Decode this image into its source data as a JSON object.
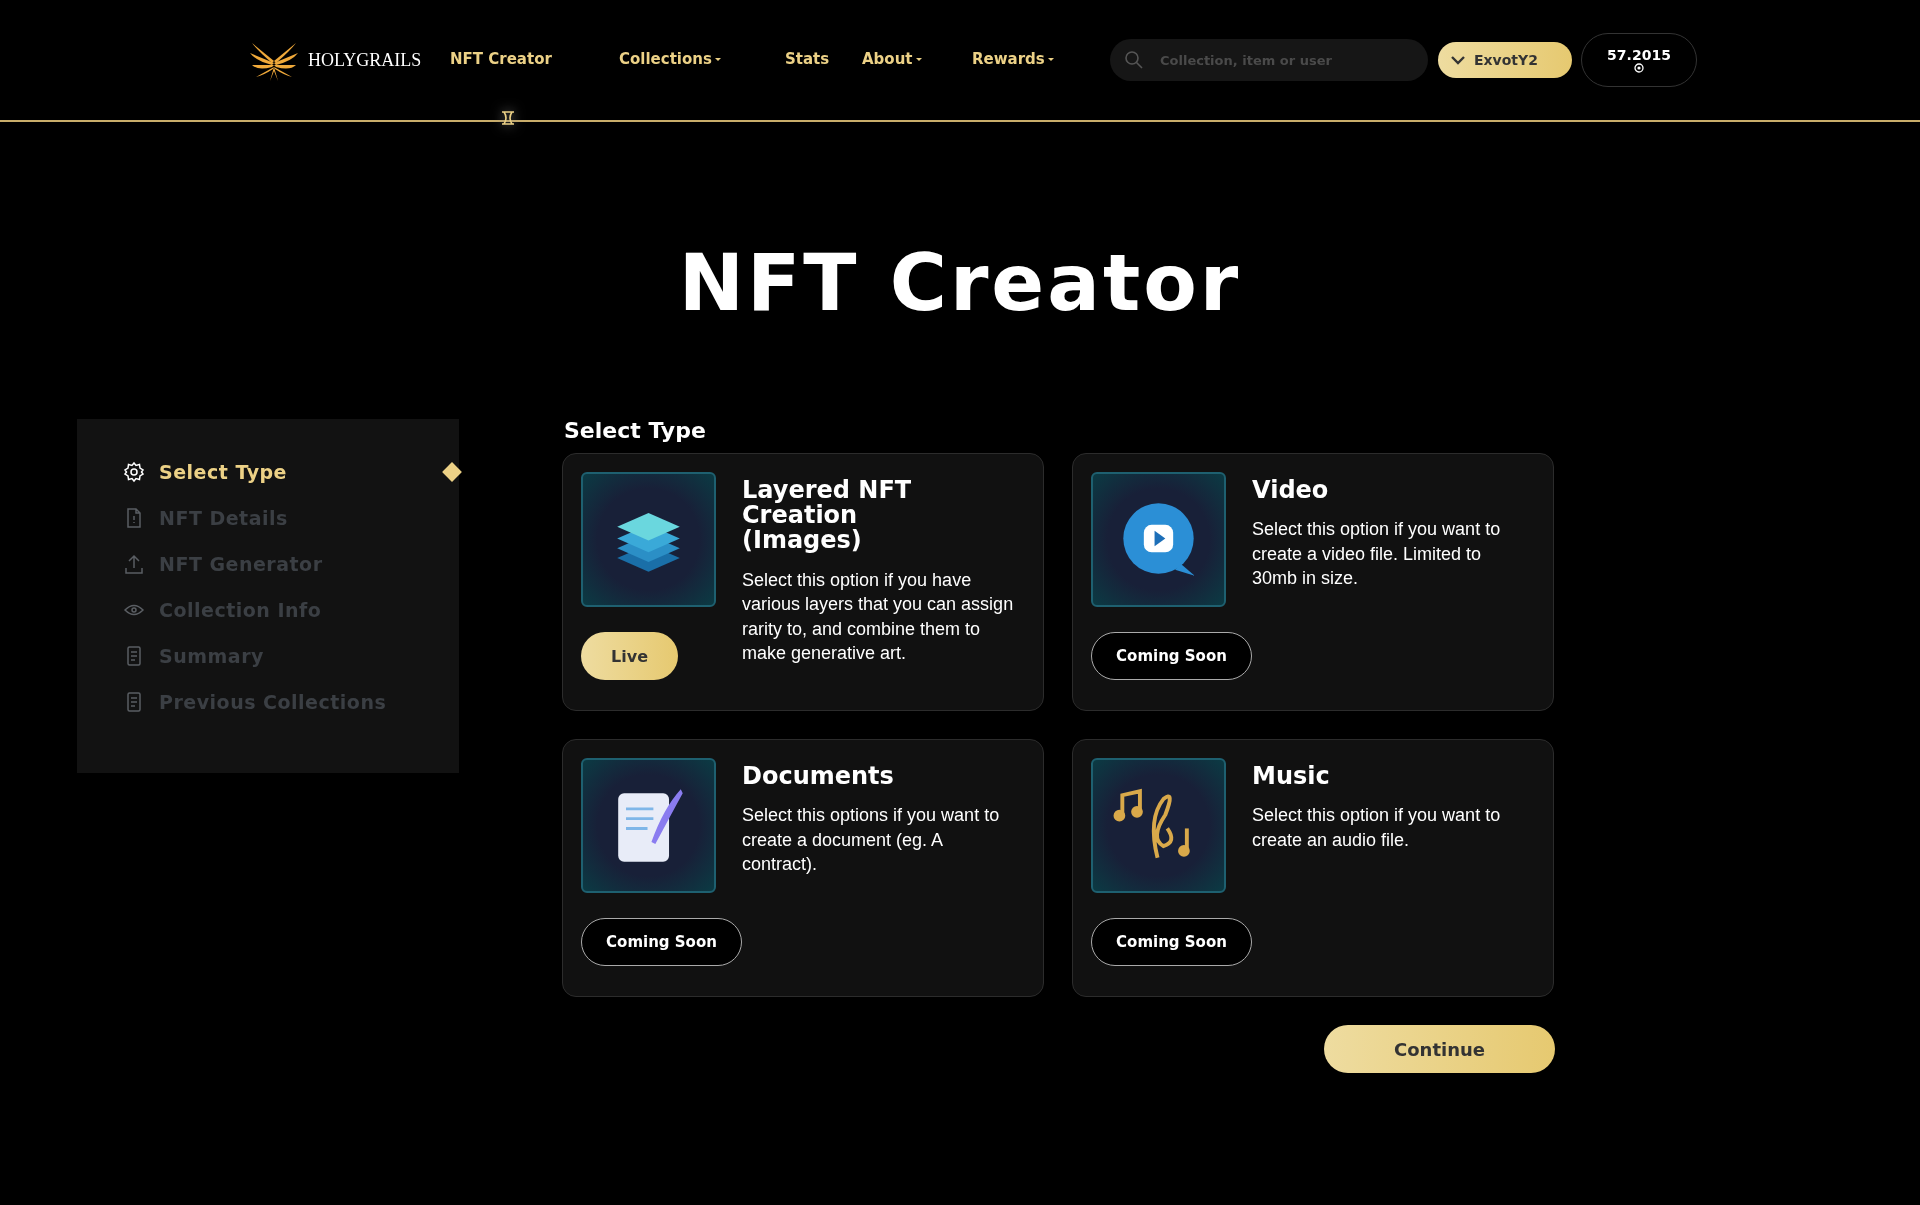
{
  "header": {
    "logo_text": "HOLYGRAILS",
    "nav": [
      {
        "label": "NFT Creator",
        "selected": true,
        "has_menu": false
      },
      {
        "label": "Collections",
        "selected": false,
        "has_menu": true
      },
      {
        "label": "Stats",
        "selected": false,
        "has_menu": false
      },
      {
        "label": "About",
        "selected": false,
        "has_menu": true
      },
      {
        "label": "Rewards",
        "selected": false,
        "has_menu": true
      }
    ],
    "search": {
      "placeholder": "Collection, item or user"
    },
    "user": "ExvotY2",
    "balance": "57.2015"
  },
  "title": "NFT Creator",
  "sidebar": {
    "items": [
      {
        "label": "Select Type",
        "selected": true
      },
      {
        "label": "NFT Details",
        "selected": false
      },
      {
        "label": "NFT Generator",
        "selected": false
      },
      {
        "label": "Collection Info",
        "selected": false
      },
      {
        "label": "Summary",
        "selected": false
      },
      {
        "label": "Previous Collections",
        "selected": false
      }
    ]
  },
  "section_title": "Select Type",
  "cards": [
    {
      "title": "Layered NFT Creation (Images)",
      "description": "Select this option if you have various layers that you can assign rarity to, and combine them to make generative art.",
      "status": {
        "kind": "live",
        "label": "Live"
      }
    },
    {
      "title": "Video",
      "description": "Select this option if you want to create a video file. Limited to 30mb in size.",
      "status": {
        "kind": "soon",
        "label": "Coming Soon"
      }
    },
    {
      "title": "Documents",
      "description": "Select this options if you want to create a document (eg. A contract).",
      "status": {
        "kind": "soon",
        "label": "Coming Soon"
      }
    },
    {
      "title": "Music",
      "description": "Select this option if you want to create an audio file.",
      "status": {
        "kind": "soon",
        "label": "Coming Soon"
      }
    }
  ],
  "continue_button": "Continue"
}
